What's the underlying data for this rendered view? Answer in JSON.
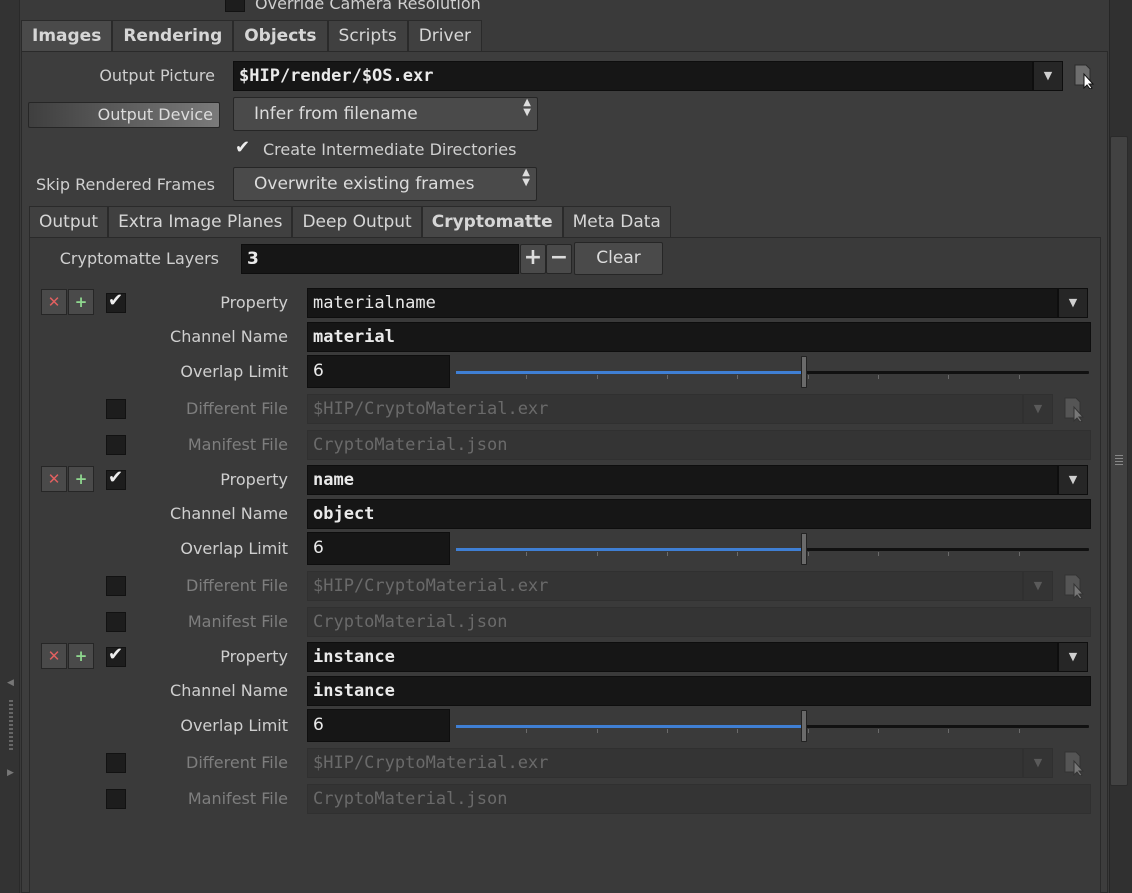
{
  "top": {
    "override_camera_label": "Override Camera Resolution",
    "override_camera_checked": false
  },
  "main_tabs": [
    {
      "label": "Images",
      "bold": true,
      "active": true
    },
    {
      "label": "Rendering",
      "bold": true,
      "active": false
    },
    {
      "label": "Objects",
      "bold": true,
      "active": false
    },
    {
      "label": "Scripts",
      "bold": false,
      "active": false
    },
    {
      "label": "Driver",
      "bold": false,
      "active": false
    }
  ],
  "images": {
    "output_picture_label": "Output Picture",
    "output_picture_value": "$HIP/render/$OS.exr",
    "output_device_label": "Output Device",
    "output_device_value": "Infer from filename",
    "create_dirs_label": "Create Intermediate Directories",
    "create_dirs_checked": true,
    "skip_frames_label": "Skip Rendered Frames",
    "skip_frames_value": "Overwrite existing frames"
  },
  "sub_tabs": [
    {
      "label": "Output",
      "active": false
    },
    {
      "label": "Extra Image Planes",
      "active": false
    },
    {
      "label": "Deep Output",
      "active": false
    },
    {
      "label": "Cryptomatte",
      "active": true
    },
    {
      "label": "Meta Data",
      "active": false
    }
  ],
  "cryptomatte": {
    "layers_label": "Cryptomatte Layers",
    "layers_value": "3",
    "plus_label": "+",
    "minus_label": "−",
    "clear_label": "Clear",
    "labels": {
      "property": "Property",
      "channel_name": "Channel Name",
      "overlap_limit": "Overlap Limit",
      "different_file": "Different File",
      "manifest_file": "Manifest File"
    },
    "layers": [
      {
        "enabled": true,
        "property": "materialname",
        "property_bold": false,
        "channel_name": "material",
        "overlap_limit": "6",
        "overlap_fraction": 0.55,
        "different_file_checked": false,
        "different_file": "$HIP/CryptoMaterial.exr",
        "manifest_checked": false,
        "manifest_file": "CryptoMaterial.json"
      },
      {
        "enabled": true,
        "property": "name",
        "property_bold": true,
        "channel_name": "object",
        "overlap_limit": "6",
        "overlap_fraction": 0.55,
        "different_file_checked": false,
        "different_file": "$HIP/CryptoMaterial.exr",
        "manifest_checked": false,
        "manifest_file": "CryptoMaterial.json"
      },
      {
        "enabled": true,
        "property": "instance",
        "property_bold": true,
        "channel_name": "instance",
        "overlap_limit": "6",
        "overlap_fraction": 0.55,
        "different_file_checked": false,
        "different_file": "$HIP/CryptoMaterial.exr",
        "manifest_checked": false,
        "manifest_file": "CryptoMaterial.json"
      }
    ]
  },
  "icons": {
    "file_chooser": "file-chooser-icon",
    "delete": "delete-x-icon",
    "insert": "insert-plus-icon",
    "dropdown": "chevron-down-icon"
  },
  "colors": {
    "slider_fill": "#3f7fd4",
    "delete": "#e06060",
    "insert": "#8fd88f"
  }
}
